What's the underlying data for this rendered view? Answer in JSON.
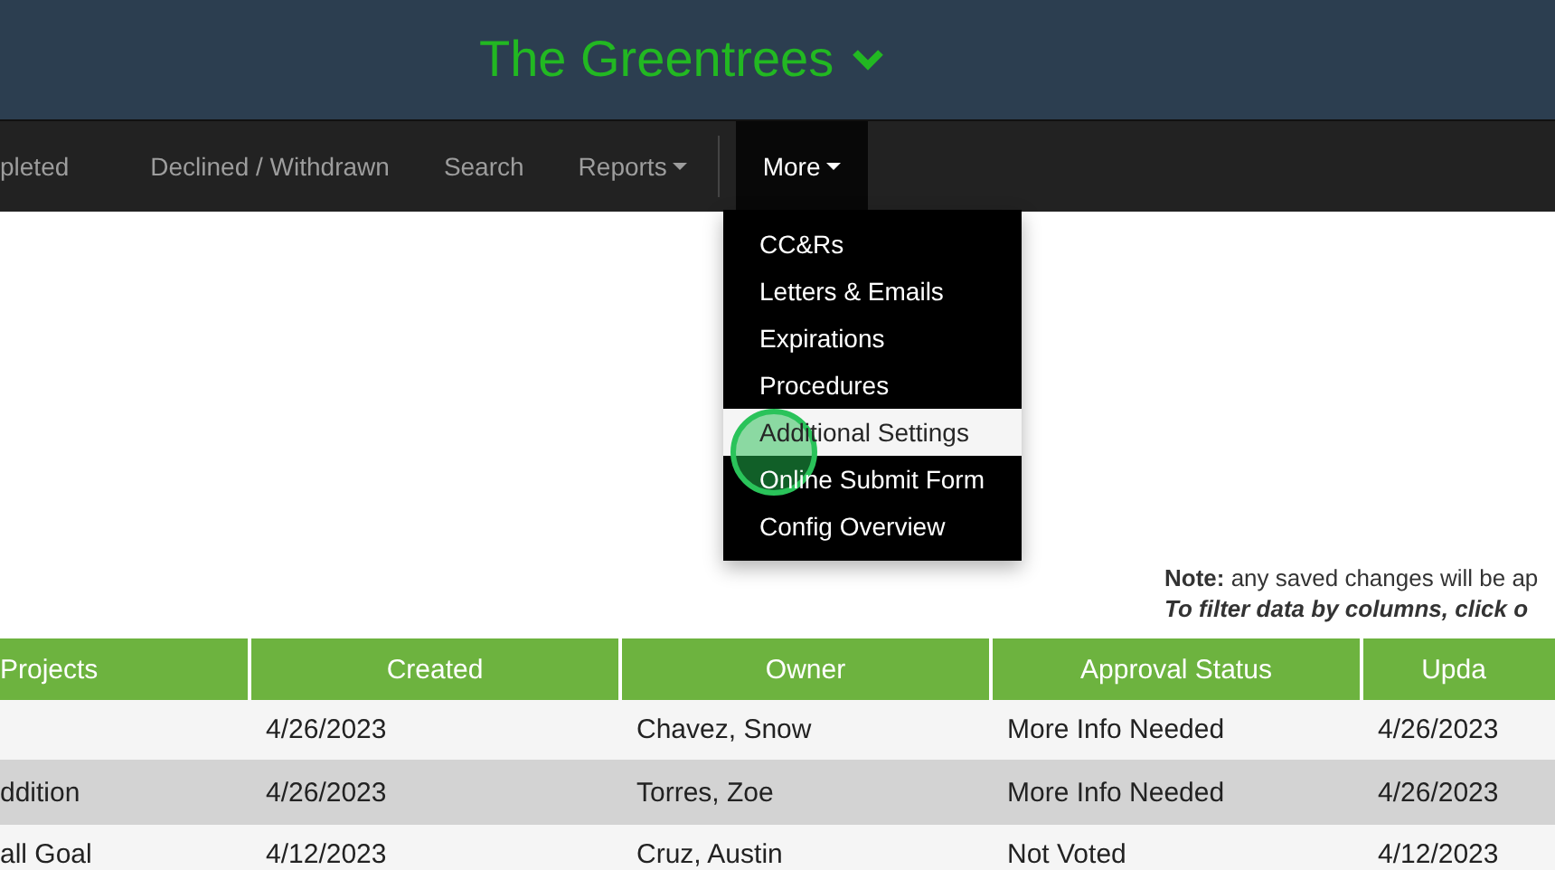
{
  "header": {
    "title": "The Greentrees"
  },
  "nav": {
    "items": [
      {
        "label": "pleted",
        "kind": "link",
        "selected": false
      },
      {
        "label": "Declined / Withdrawn",
        "kind": "link",
        "selected": false
      },
      {
        "label": "Search",
        "kind": "link",
        "selected": false
      },
      {
        "label": "Reports",
        "kind": "dropdown",
        "selected": false
      },
      {
        "label": "More",
        "kind": "dropdown",
        "selected": true
      }
    ]
  },
  "menu": {
    "items": [
      {
        "label": "CC&Rs",
        "selected": false
      },
      {
        "label": "Letters & Emails",
        "selected": false
      },
      {
        "label": "Expirations",
        "selected": false
      },
      {
        "label": "Procedures",
        "selected": false
      },
      {
        "label": "Additional Settings",
        "selected": true
      },
      {
        "label": "Online Submit Form",
        "selected": false
      },
      {
        "label": "Config Overview",
        "selected": false
      }
    ]
  },
  "notes": [
    "**Note:** any saved changes will be ap",
    "To filter data by columns, click o"
  ],
  "table": {
    "columns": [
      "Projects",
      "Created",
      "Owner",
      "Approval Status",
      "Upda"
    ],
    "rows": [
      [
        "",
        "4/26/2023",
        "Chavez, Snow",
        "More Info Needed",
        "4/26/2023"
      ],
      [
        "ddition",
        "4/26/2023",
        "Torres, Zoe",
        "More Info Needed",
        "4/26/2023"
      ],
      [
        "all Goal",
        "4/12/2023",
        "Cruz, Austin",
        "Not Voted",
        "4/12/2023"
      ]
    ]
  }
}
